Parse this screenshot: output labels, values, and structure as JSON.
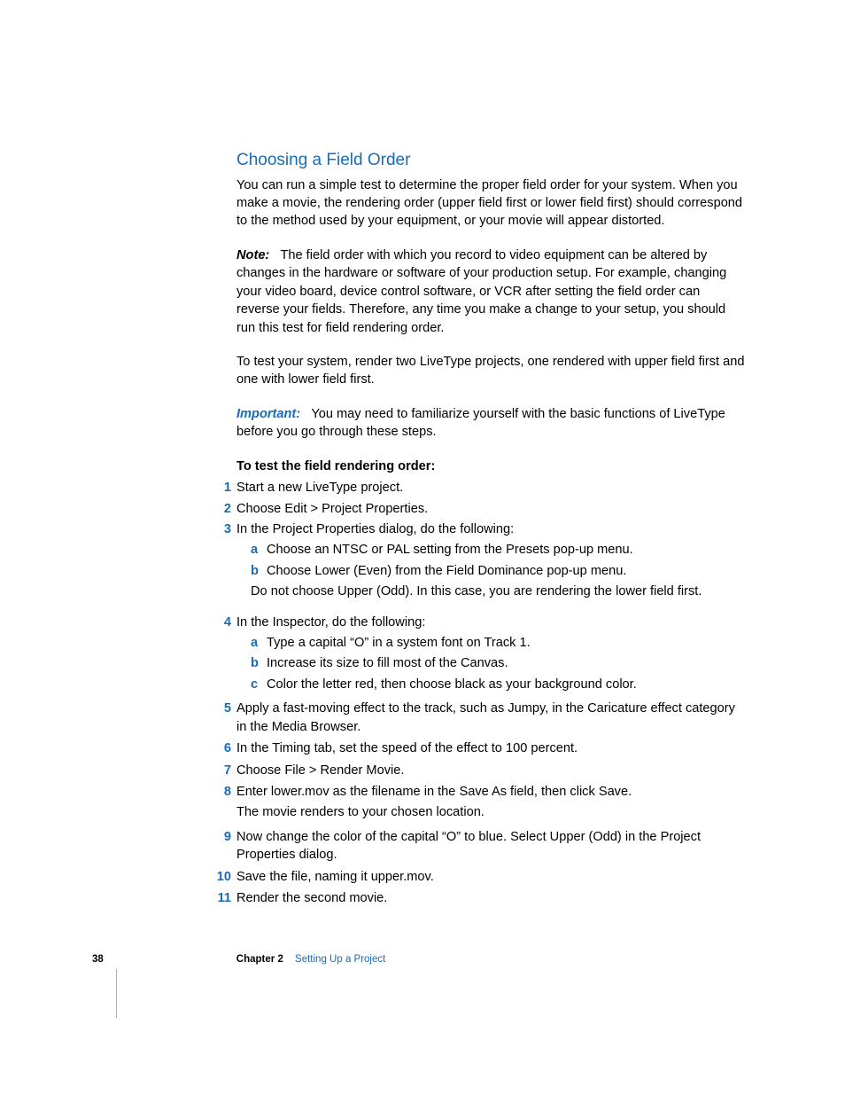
{
  "heading": "Choosing a Field Order",
  "intro": "You can run a simple test to determine the proper field order for your system. When you make a movie, the rendering order (upper field first or lower field first) should correspond to the method used by your equipment, or your movie will appear distorted.",
  "note_label": "Note:",
  "note_body": "The field order with which you record to video equipment can be altered by changes in the hardware or software of your production setup. For example, changing your video board, device control software, or VCR after setting the field order can reverse your fields. Therefore, any time you make a change to your setup, you should run this test for field rendering order.",
  "test_line": "To test your system, render two LiveType projects, one rendered with upper field first and one with lower field first.",
  "important_label": "Important:",
  "important_body": "You may need to familiarize yourself with the basic functions of LiveType before you go through these steps.",
  "steps_title": "To test the field rendering order:",
  "steps": {
    "s1": "Start a new LiveType project.",
    "s2": "Choose Edit > Project Properties.",
    "s3_lead": "In the Project Properties dialog, do the following:",
    "s3a": "Choose an NTSC or PAL setting from the Presets pop-up menu.",
    "s3b": "Choose Lower (Even) from the Field Dominance pop-up menu.",
    "s3_tail": "Do not choose Upper (Odd). In this case, you are rendering the lower field first.",
    "s4_lead": "In the Inspector, do the following:",
    "s4a": "Type a capital “O” in a system font on Track 1.",
    "s4b": "Increase its size to fill most of the Canvas.",
    "s4c": "Color the letter red, then choose black as your background color.",
    "s5": "Apply a fast-moving effect to the track, such as Jumpy, in the Caricature effect category in the Media Browser.",
    "s6": "In the Timing tab, set the speed of the effect to 100 percent.",
    "s7": "Choose File > Render Movie.",
    "s8": "Enter lower.mov as the filename in the Save As field, then click Save.",
    "s8_tail": "The movie renders to your chosen location.",
    "s9": "Now change the color of the capital “O” to blue. Select Upper (Odd) in the Project Properties dialog.",
    "s10": "Save the file, naming it upper.mov.",
    "s11": "Render the second movie."
  },
  "nums": {
    "n1": "1",
    "n2": "2",
    "n3": "3",
    "n4": "4",
    "n5": "5",
    "n6": "6",
    "n7": "7",
    "n8": "8",
    "n9": "9",
    "n10": "10",
    "n11": "11",
    "a": "a",
    "b": "b",
    "c": "c"
  },
  "footer": {
    "page": "38",
    "chapter_label": "Chapter 2",
    "chapter_title": "Setting Up a Project"
  }
}
